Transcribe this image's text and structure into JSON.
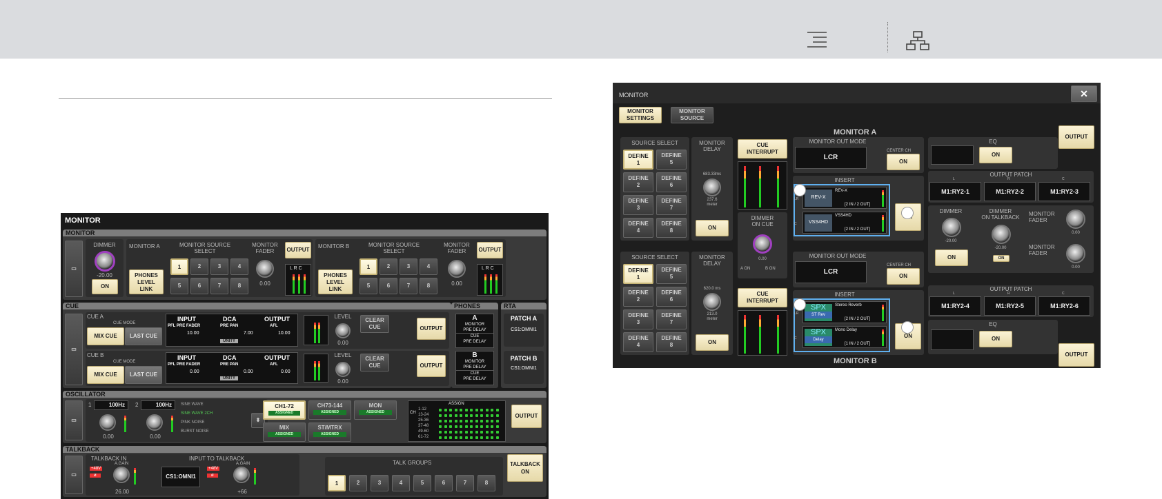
{
  "header": {
    "menu_icon": "menu-icon",
    "tree_icon": "hierarchy-icon"
  },
  "left": {
    "title": "MONITOR",
    "monitor": {
      "section": "MONITOR",
      "dimmer": "DIMMER",
      "dimmer_val": "-20.00",
      "on": "ON",
      "mon_a": "MONITOR A",
      "phones_link": "PHONES\nLEVEL\nLINK",
      "source_select": "MONITOR SOURCE\nSELECT",
      "buttons": [
        "1",
        "2",
        "3",
        "4",
        "5",
        "6",
        "7",
        "8"
      ],
      "fader": "MONITOR\nFADER",
      "fader_val": "0.00",
      "output": "OUTPUT",
      "mon_b": "MONITOR B",
      "lrc": "L R C"
    },
    "cue": {
      "section": "CUE",
      "cue_a": "CUE A",
      "cue_b": "CUE B",
      "cue_mode": "CUE MODE",
      "mix_cue": "MIX CUE",
      "last_cue": "LAST CUE",
      "input": "INPUT",
      "pfl": "PFL PRE FADER",
      "in_a": "10.00",
      "in_b": "0.00",
      "dca": "DCA",
      "pre_pan": "PRE PAN",
      "dca_a": "7.00",
      "dca_b": "0.00",
      "unity": "UNITY",
      "out": "OUTPUT",
      "afl": "AFL",
      "out_a": "10.00",
      "out_b": "0.00",
      "level": "LEVEL",
      "level_val": "0.00",
      "clear": "CLEAR\nCUE",
      "output": "OUTPUT"
    },
    "phones": {
      "section": "PHONES",
      "a": "A",
      "b": "B",
      "monitor_pre_delay": "MONITOR\nPRE DELAY",
      "cue_pre_delay": "CUE\nPRE DELAY"
    },
    "rta": {
      "section": "RTA",
      "patch_a": "PATCH A",
      "patch_a_val": "CS1:OMNI1",
      "patch_b": "PATCH B",
      "patch_b_val": "CS1:OMNI1"
    },
    "osc": {
      "section": "OSCILLATOR",
      "n1": "1",
      "f1": "100Hz",
      "n2": "2",
      "f2": "100Hz",
      "v1": "0.00",
      "v2": "0.00",
      "waves": [
        "SINE WAVE",
        "SINE WAVE 2CH",
        "PINK NOISE",
        "BURST NOISE"
      ],
      "assign_btns": [
        {
          "label": "CH1-72",
          "badge": "ASSIGNED"
        },
        {
          "label": "CH73-144",
          "badge": "ASSIGNED"
        },
        {
          "label": "MON",
          "badge": "ASSIGNED"
        },
        {
          "label": "MIX",
          "badge": "ASSIGNED"
        },
        {
          "label": "ST/MTRX",
          "badge": "ASSIGNED"
        }
      ],
      "assign": "ASSIGN",
      "ch": "CH",
      "rows": [
        "1-12",
        "13-24",
        "25-36",
        "37-48",
        "49-60",
        "61-72"
      ],
      "output": "OUTPUT"
    },
    "talk": {
      "section": "TALKBACK",
      "in": "TALKBACK IN",
      "again": "A.GAIN",
      "plus48": "+48V",
      "phase": "ø",
      "val1": "26.00",
      "input_to": "INPUT TO TALKBACK",
      "patch": "CS1:OMNI1",
      "val2": "+66",
      "groups": "TALK GROUPS",
      "gbtns": [
        "1",
        "2",
        "3",
        "4",
        "5",
        "6",
        "7",
        "8"
      ],
      "talkback_on": "TALKBACK\nON"
    }
  },
  "right": {
    "title": "MONITOR",
    "close": "✕",
    "tabs": [
      "MONITOR\nSETTINGS",
      "MONITOR\nSOURCE"
    ],
    "mon_a": "MONITOR A",
    "mon_b": "MONITOR B",
    "source_select": "SOURCE SELECT",
    "define": [
      "DEFINE\n1",
      "DEFINE\n5",
      "DEFINE\n2",
      "DEFINE\n6",
      "DEFINE\n3",
      "DEFINE\n7",
      "DEFINE\n4",
      "DEFINE\n8"
    ],
    "delay": "MONITOR\nDELAY",
    "delay_a": "683.33ms",
    "delay_a2": "237.6\nmeter",
    "delay_b": "620.0 ms",
    "delay_b2": "213.0\nmeter",
    "on": "ON",
    "cue_int": "CUE\nINTERRUPT",
    "dimmer_on_cue": "DIMMER\nON CUE",
    "doc_val": "0.00",
    "doc_a": "A  ON",
    "doc_b": "B  ON",
    "out_mode": "MONITOR OUT MODE",
    "lcr": "LCR",
    "center": "CENTER CH",
    "insert": "INSERT",
    "ins_a": [
      {
        "ch": "LR",
        "name": "REV-X",
        "io": "[2 IN / 2 OUT]",
        "logo": "REV-X"
      },
      {
        "ch": "C",
        "name": "VSS4HD",
        "io": "[2 IN / 2 OUT]",
        "logo": "VSS4HD"
      }
    ],
    "ins_b": [
      {
        "ch": "LR",
        "name": "Stereo Reverb",
        "io": "[2 IN / 2 OUT]",
        "logo": "SPX",
        "sub": "ST Rev"
      },
      {
        "ch": "C",
        "name": "Mono Delay",
        "io": "[1 IN / 2 OUT]",
        "logo": "SPX",
        "sub": "Delay"
      }
    ],
    "eq": "EQ",
    "output": "OUTPUT",
    "patch": "OUTPUT PATCH",
    "lrc": [
      "L",
      "R",
      "C"
    ],
    "patch_a": [
      "M1:RY2-1",
      "M1:RY2-2",
      "M1:RY2-3"
    ],
    "patch_b": [
      "M1:RY2-4",
      "M1:RY2-5",
      "M1:RY2-6"
    ],
    "dimmer": "DIMMER",
    "dim_val": "-20.00",
    "dim_talk": "DIMMER\nON TALKBACK",
    "dt_val": "-20.00",
    "fader": "MONITOR\nFADER",
    "fader_val": "0.00"
  }
}
